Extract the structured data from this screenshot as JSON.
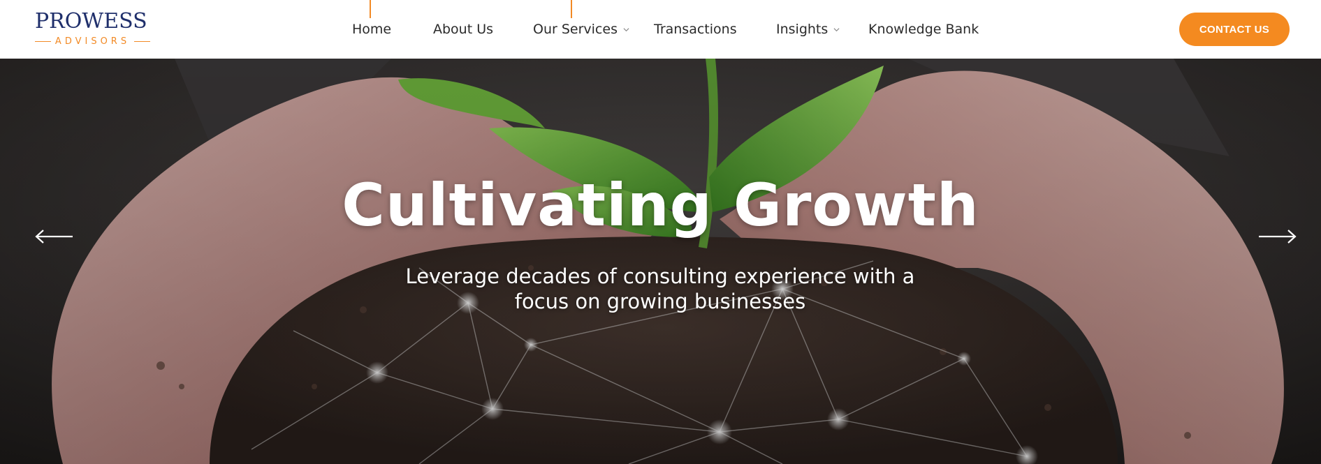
{
  "header": {
    "logo": {
      "title": "PROWESS",
      "subtitle": "ADVISORS",
      "navy": "#1f2f6b",
      "orange": "#f28a25"
    },
    "nav": [
      {
        "label": "Home",
        "has_dropdown": false,
        "marker": true
      },
      {
        "label": "About Us",
        "has_dropdown": false,
        "marker": false
      },
      {
        "label": "Our Services",
        "has_dropdown": true,
        "marker": true
      },
      {
        "label": "Transactions",
        "has_dropdown": false,
        "marker": false
      },
      {
        "label": "Insights",
        "has_dropdown": true,
        "marker": false
      },
      {
        "label": "Knowledge Bank",
        "has_dropdown": false,
        "marker": false
      }
    ],
    "cta_label": "CONTACT US",
    "cta_color": "#f48a20"
  },
  "hero": {
    "title": "Cultivating Growth",
    "subtitle": "Leverage decades of consulting experience with a focus on growing businesses",
    "prev_icon": "arrow-left-icon",
    "next_icon": "arrow-right-icon"
  }
}
